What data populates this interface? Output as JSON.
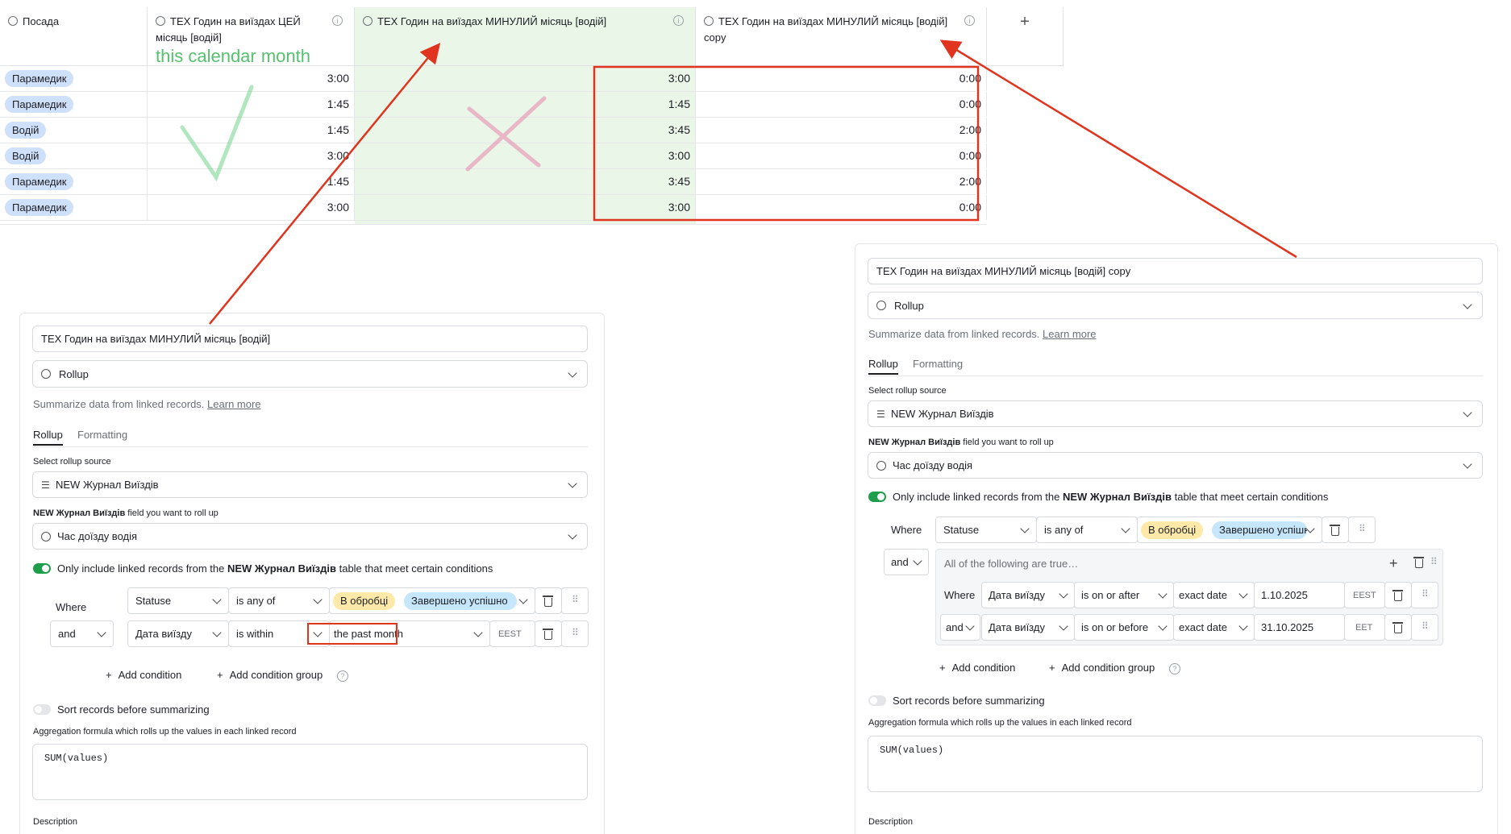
{
  "grid": {
    "columns": [
      {
        "label": "Посада"
      },
      {
        "label": "ТЕХ Годин на виїздах ЦЕЙ місяць [водій]",
        "annotation": "this calendar month"
      },
      {
        "label": "ТЕХ Годин на виїздах МИНУЛИЙ місяць [водій]"
      },
      {
        "label": "ТЕХ Годин на виїздах МИНУЛИЙ місяць [водій] copy"
      }
    ],
    "add_column": "+",
    "rows": [
      {
        "role": "Парамедик",
        "this_month": "3:00",
        "last_month": "3:00",
        "last_copy": "0:00"
      },
      {
        "role": "Парамедик",
        "this_month": "1:45",
        "last_month": "1:45",
        "last_copy": "0:00"
      },
      {
        "role": "Водій",
        "this_month": "1:45",
        "last_month": "3:45",
        "last_copy": "2:00"
      },
      {
        "role": "Водій",
        "this_month": "3:00",
        "last_month": "3:00",
        "last_copy": "0:00"
      },
      {
        "role": "Парамедик",
        "this_month": "1:45",
        "last_month": "3:45",
        "last_copy": "2:00"
      },
      {
        "role": "Парамедик",
        "this_month": "3:00",
        "last_month": "3:00",
        "last_copy": "0:00"
      }
    ]
  },
  "left_panel": {
    "field_name": "ТЕХ Годин на виїздах МИНУЛИЙ місяць [водій]",
    "field_type": "Rollup",
    "summary": "Summarize data from linked records.",
    "learn_more": "Learn more",
    "tabs": [
      "Rollup",
      "Formatting"
    ],
    "source_label": "Select rollup source",
    "source_value": "NEW Журнал Виїздів",
    "field_label_bold": "NEW Журнал Виїздів",
    "field_label_rest": " field you want to roll up",
    "field_value": "Час доїзду водія",
    "conditions_prefix": "Only include linked records from the ",
    "conditions_table": "NEW Журнал Виїздів",
    "conditions_suffix": " table that meet certain conditions",
    "cond1": {
      "join": "Where",
      "field": "Statuse",
      "op": "is any of",
      "tag1": "В обробці",
      "tag2": "Завершено успішно"
    },
    "cond2": {
      "join": "and",
      "field": "Дата виїзду",
      "op": "is within",
      "value": "the past month",
      "tz": "EEST"
    },
    "add_condition": "Add condition",
    "add_group": "Add condition group",
    "sort_label": "Sort records before summarizing",
    "agg_label": "Aggregation formula which rolls up the values in each linked record",
    "formula": "SUM(values)",
    "description": "Description"
  },
  "right_panel": {
    "field_name": "ТЕХ Годин на виїздах МИНУЛИЙ місяць [водій] copy",
    "field_type": "Rollup",
    "summary": "Summarize data from linked records.",
    "learn_more": "Learn more",
    "tabs": [
      "Rollup",
      "Formatting"
    ],
    "source_label": "Select rollup source",
    "source_value": "NEW Журнал Виїздів",
    "field_label_bold": "NEW Журнал Виїздів",
    "field_label_rest": " field you want to roll up",
    "field_value": "Час доїзду водія",
    "conditions_prefix": "Only include linked records from the ",
    "conditions_table": "NEW Журнал Виїздів",
    "conditions_suffix": " table that meet certain conditions",
    "cond1": {
      "join": "Where",
      "field": "Statuse",
      "op": "is any of",
      "tag1": "В обробці",
      "tag2": "Завершено успішно"
    },
    "group_join": "and",
    "group_title": "All of the following are true…",
    "gcond1": {
      "join": "Where",
      "field": "Дата виїзду",
      "op": "is on or after",
      "mode": "exact date",
      "value": "1.10.2025",
      "tz": "EEST"
    },
    "gcond2": {
      "join": "and",
      "field": "Дата виїзду",
      "op": "is on or before",
      "mode": "exact date",
      "value": "31.10.2025",
      "tz": "EET"
    },
    "add_condition": "Add condition",
    "add_group": "Add condition group",
    "sort_label": "Sort records before summarizing",
    "agg_label": "Aggregation formula which rolls up the values in each linked record",
    "formula": "SUM(values)",
    "description": "Description"
  },
  "colors": {
    "annotation_red": "#e0341e",
    "highlight_green": "#eaf7e8",
    "annotation_green": "#57c070",
    "toggle_on": "#1e9e4b"
  }
}
